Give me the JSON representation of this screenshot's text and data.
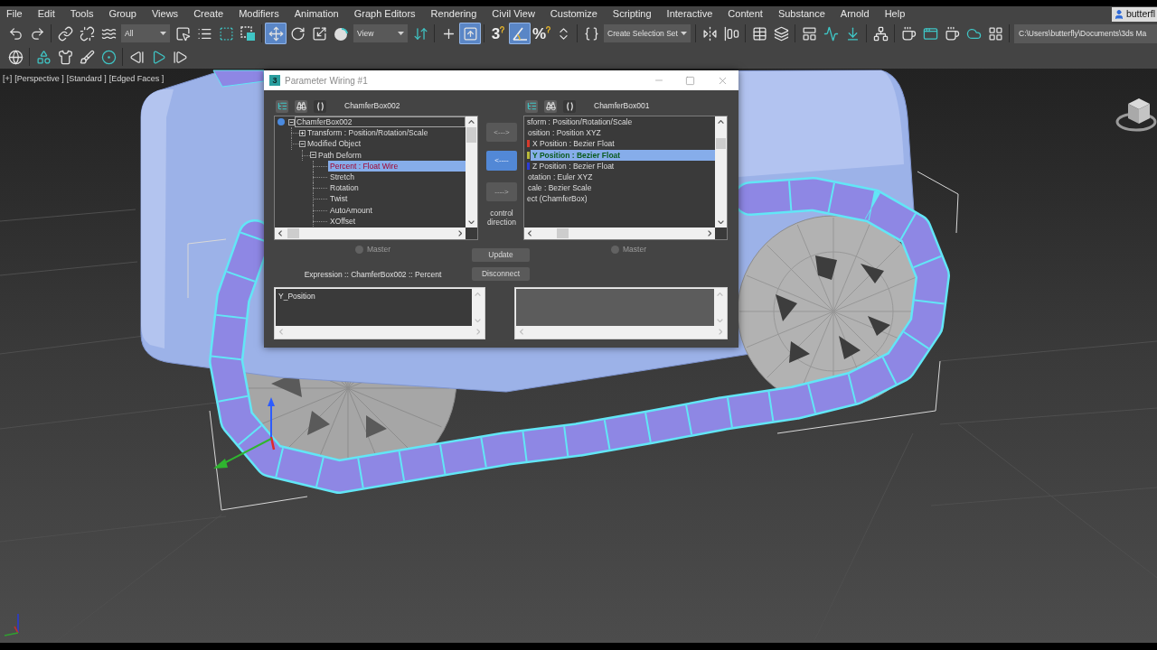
{
  "menu_bar": {
    "items": [
      "File",
      "Edit",
      "Tools",
      "Group",
      "Views",
      "Create",
      "Modifiers",
      "Animation",
      "Graph Editors",
      "Rendering",
      "Civil View",
      "Customize",
      "Scripting",
      "Interactive",
      "Content",
      "Substance",
      "Arnold",
      "Help"
    ],
    "user": "butterfl"
  },
  "main_toolbar": {
    "groups": [
      [
        {
          "kind": "button",
          "selected": false
        },
        {
          "kind": "button",
          "selected": false
        }
      ],
      [
        {
          "kind": "button",
          "selected": false
        },
        {
          "kind": "button",
          "selected": false
        },
        {
          "kind": "button",
          "selected": false
        },
        {
          "kind": "dropdown",
          "value": "All"
        },
        {
          "kind": "button",
          "selected": false
        },
        {
          "kind": "button",
          "selected": false
        },
        {
          "kind": "button",
          "selected": false
        },
        {
          "kind": "button",
          "selected": false
        }
      ],
      [
        {
          "kind": "button",
          "selected": true
        },
        {
          "kind": "button",
          "selected": false
        },
        {
          "kind": "button",
          "selected": false
        },
        {
          "kind": "button",
          "selected": false
        },
        {
          "kind": "dropdown",
          "value": "View"
        },
        {
          "kind": "button",
          "selected": false
        }
      ],
      [
        {
          "kind": "button",
          "selected": false
        },
        {
          "kind": "button",
          "selected": true
        }
      ],
      [
        {
          "kind": "button",
          "selected": false,
          "label": "3"
        },
        {
          "kind": "button",
          "selected": true
        },
        {
          "kind": "button",
          "selected": false,
          "label": "%"
        },
        {
          "kind": "button",
          "selected": false
        }
      ],
      [
        {
          "kind": "button",
          "selected": false
        },
        {
          "kind": "dropdown",
          "value": "Create Selection Set"
        }
      ],
      [
        {
          "kind": "button",
          "selected": false
        },
        {
          "kind": "button",
          "selected": false
        }
      ],
      [
        {
          "kind": "button",
          "selected": false
        },
        {
          "kind": "button",
          "selected": false
        }
      ],
      [
        {
          "kind": "button",
          "selected": false
        },
        {
          "kind": "button",
          "selected": false
        },
        {
          "kind": "button",
          "selected": false
        }
      ],
      [
        {
          "kind": "button",
          "selected": false
        }
      ],
      [
        {
          "kind": "button",
          "selected": false
        },
        {
          "kind": "button",
          "selected": false
        },
        {
          "kind": "button",
          "selected": false
        },
        {
          "kind": "button",
          "selected": false
        },
        {
          "kind": "button",
          "selected": false
        }
      ],
      [
        {
          "kind": "field",
          "value": "C:\\Users\\butterfly\\Documents\\3ds Ma"
        }
      ]
    ]
  },
  "secondary_toolbar": {
    "groups": [
      [
        {
          "kind": "button",
          "selected": false
        }
      ],
      [
        {
          "kind": "button",
          "selected": false
        },
        {
          "kind": "button",
          "selected": false
        },
        {
          "kind": "button",
          "selected": false
        },
        {
          "kind": "button",
          "selected": false
        }
      ],
      [
        {
          "kind": "button",
          "selected": false
        },
        {
          "kind": "button",
          "selected": false
        },
        {
          "kind": "button",
          "selected": false
        }
      ]
    ]
  },
  "viewport": {
    "labels": [
      "[+]",
      "[Perspective ]",
      "[Standard ]",
      "[Edged Faces ]"
    ]
  },
  "dialog": {
    "title": "Parameter Wiring #1",
    "logo": "3",
    "panes": [
      {
        "object": "ChamferBox002",
        "tree": [
          {
            "label": "ChamferBox002",
            "expanded": true,
            "selected": false,
            "focused": true,
            "children": [
              {
                "label": "Transform : Position/Rotation/Scale",
                "expanded": false,
                "selected": false,
                "focused": false
              },
              {
                "label": "Modified Object",
                "expanded": true,
                "selected": false,
                "focused": false,
                "children": [
                  {
                    "label": "Path Deform",
                    "expanded": true,
                    "selected": false,
                    "focused": false,
                    "children": [
                      {
                        "label": "Percent : Float Wire",
                        "selected": true,
                        "focused": false
                      },
                      {
                        "label": "Stretch",
                        "selected": false,
                        "focused": false
                      },
                      {
                        "label": "Rotation",
                        "selected": false,
                        "focused": false
                      },
                      {
                        "label": "Twist",
                        "selected": false,
                        "focused": false
                      },
                      {
                        "label": "AutoAmount",
                        "selected": false,
                        "focused": false
                      },
                      {
                        "label": "XOffset",
                        "selected": false,
                        "focused": false
                      }
                    ]
                  }
                ]
              }
            ]
          }
        ],
        "master": {
          "label": "Master",
          "disabled": true
        }
      },
      {
        "object": "ChamferBox001",
        "tree": [
          {
            "label": "sform : Position/Rotation/Scale",
            "selected": false,
            "focused": false,
            "children": [
              {
                "label": "osition : Position XYZ",
                "selected": false,
                "focused": false,
                "children": [
                  {
                    "label": "X Position : Bezier Float",
                    "color": "#d63a2c",
                    "selected": false,
                    "focused": false
                  },
                  {
                    "label": "Y Position : Bezier Float",
                    "color": "#b9b93a",
                    "selected": true,
                    "focused": false
                  },
                  {
                    "label": "Z Position : Bezier Float",
                    "color": "#2c3cd6",
                    "selected": false,
                    "focused": false
                  }
                ]
              },
              {
                "label": "otation : Euler XYZ",
                "selected": false,
                "focused": false
              },
              {
                "label": "cale : Bezier Scale",
                "selected": false,
                "focused": false
              }
            ]
          },
          {
            "label": "ect (ChamferBox)",
            "selected": false,
            "focused": false
          }
        ],
        "master": {
          "label": "Master",
          "disabled": true
        }
      }
    ],
    "direction_buttons": [
      {
        "label": "<--->",
        "selected": false
      },
      {
        "label": "<----",
        "selected": true
      },
      {
        "label": "---->",
        "selected": false
      }
    ],
    "direction_label": "control direction",
    "actions": [
      "Update",
      "Disconnect"
    ],
    "expression_label": "Expression :: ChamferBox002 :: Percent",
    "expressions": [
      {
        "value": "Y_Position",
        "disabled": false
      },
      {
        "disabled": true
      }
    ]
  }
}
